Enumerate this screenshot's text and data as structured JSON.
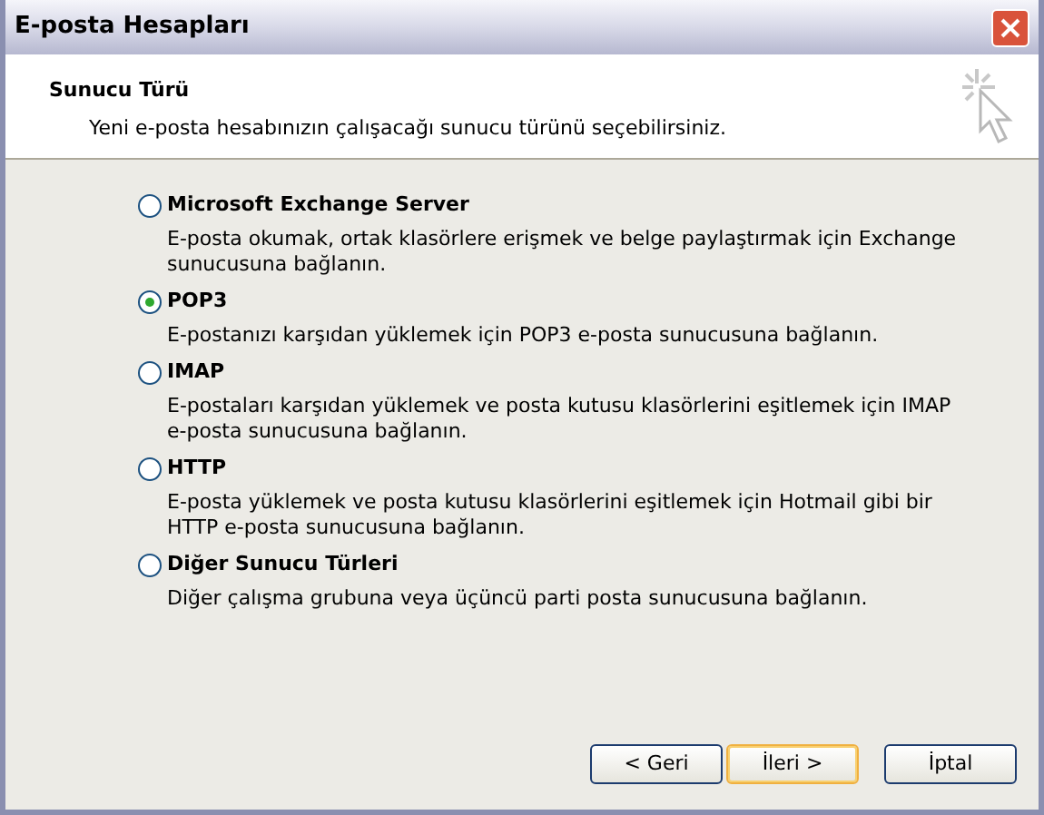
{
  "window": {
    "title": "E-posta Hesapları"
  },
  "header": {
    "title": "Sunucu Türü",
    "subtitle": "Yeni e-posta hesabınızın çalışacağı sunucu türünü seçebilirsiniz."
  },
  "options": [
    {
      "label": "Microsoft Exchange Server",
      "description": "E-posta okumak, ortak klasörlere erişmek ve belge paylaştırmak için Exchange sunucusuna bağlanın.",
      "selected": false
    },
    {
      "label": "POP3",
      "description": "E-postanızı karşıdan yüklemek için POP3 e-posta sunucusuna bağlanın.",
      "selected": true
    },
    {
      "label": "IMAP",
      "description": "E-postaları karşıdan yüklemek ve posta kutusu klasörlerini eşitlemek için IMAP e-posta sunucusuna bağlanın.",
      "selected": false
    },
    {
      "label": "HTTP",
      "description": "E-posta yüklemek ve posta kutusu klasörlerini eşitlemek için Hotmail gibi bir HTTP e-posta sunucusuna bağlanın.",
      "selected": false
    },
    {
      "label": "Diğer Sunucu Türleri",
      "description": "Diğer çalışma grubuna veya üçüncü parti posta sunucusuna bağlanın.",
      "selected": false
    }
  ],
  "buttons": [
    {
      "label": "< Geri",
      "default": false
    },
    {
      "label": "İleri >",
      "default": true
    },
    {
      "label": "İptal",
      "default": false
    }
  ]
}
